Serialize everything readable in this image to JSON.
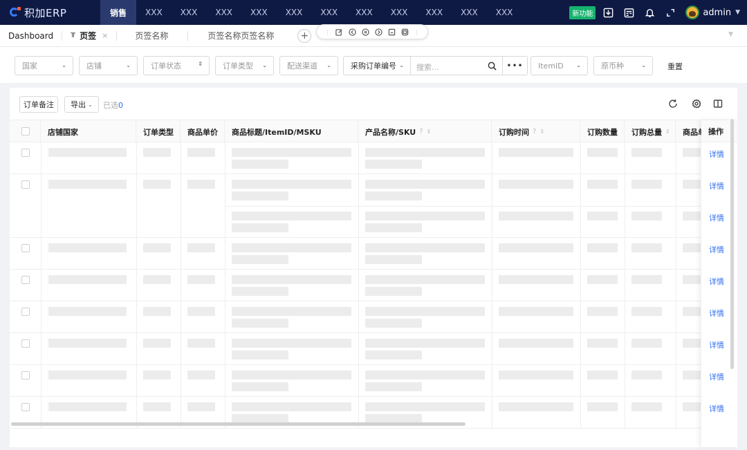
{
  "app": {
    "logo_text": "积加ERP",
    "nav": [
      "销售",
      "XXX",
      "XXX",
      "XXX",
      "XXX",
      "XXX",
      "XXX",
      "XXX",
      "XXX",
      "XXX",
      "XXX",
      "XXX"
    ],
    "new_feature_badge": "新功能",
    "user": "admin"
  },
  "tabs": {
    "dashboard": "Dashboard",
    "current": "页签",
    "close_icon": "×",
    "tab2": "页签名称",
    "tab3": "页签名称页签名称",
    "add": "+"
  },
  "filters": {
    "country": "国家",
    "store": "店铺",
    "order_status": "订单状态",
    "order_type": "订单类型",
    "channel": "配送渠道",
    "po_field": "采购订单编号",
    "search_placeholder": "搜索...",
    "more": "•••",
    "item_id": "ItemID",
    "currency": "原币种",
    "reset": "重置"
  },
  "toolbar": {
    "remark_btn": "订单备注",
    "export_btn": "导出",
    "selected_label": "已选",
    "selected_count": "0"
  },
  "table": {
    "columns": [
      "店铺国家",
      "订单类型",
      "商品单价",
      "商品标题/ItemID/MSKU",
      "产品名称/SKU",
      "订购时间",
      "订购数量",
      "订购总量",
      "商品单"
    ],
    "op_header": "操作",
    "row_link": "详情",
    "row_count": 9
  },
  "colors": {
    "topbar": "#0e1a44",
    "accent": "#2e6ff3",
    "new_badge": "#16b36e"
  }
}
